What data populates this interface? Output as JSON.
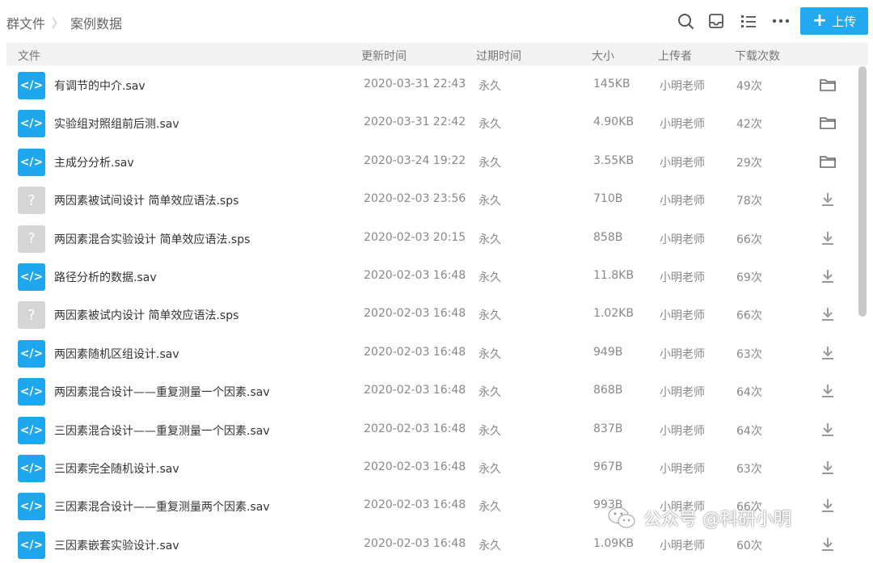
{
  "breadcrumb": {
    "root": "群文件",
    "separator": "〉",
    "current": "案例数据"
  },
  "toolbar": {
    "search_icon": "search-icon",
    "inbox_icon": "inbox-icon",
    "list_icon": "list-view-icon",
    "more_icon": "more-icon",
    "upload_label": "上传"
  },
  "colors": {
    "accent": "#21a9f1",
    "code_icon": "#1ea7ef",
    "unknown_icon": "#d5d5d5"
  },
  "table": {
    "columns": [
      "文件",
      "更新时间",
      "过期时间",
      "大小",
      "上传者",
      "下载次数"
    ],
    "rows": [
      {
        "name": "有调节的中介.sav",
        "time": "2020-03-31 22:43",
        "expire": "永久",
        "size": "145KB",
        "uploader": "小明老师",
        "downloads": "49次",
        "type": "code",
        "action": "folder-icon"
      },
      {
        "name": "实验组对照组前后测.sav",
        "time": "2020-03-31 22:42",
        "expire": "永久",
        "size": "4.90KB",
        "uploader": "小明老师",
        "downloads": "42次",
        "type": "code",
        "action": "folder-icon"
      },
      {
        "name": "主成分分析.sav",
        "time": "2020-03-24 19:22",
        "expire": "永久",
        "size": "3.55KB",
        "uploader": "小明老师",
        "downloads": "29次",
        "type": "code",
        "action": "folder-icon"
      },
      {
        "name": "两因素被试间设计 简单效应语法.sps",
        "time": "2020-02-03 23:56",
        "expire": "永久",
        "size": "710B",
        "uploader": "小明老师",
        "downloads": "78次",
        "type": "unknown",
        "action": "download-icon"
      },
      {
        "name": "两因素混合实验设计 简单效应语法.sps",
        "time": "2020-02-03 20:15",
        "expire": "永久",
        "size": "858B",
        "uploader": "小明老师",
        "downloads": "66次",
        "type": "unknown",
        "action": "download-icon"
      },
      {
        "name": "路径分析的数据.sav",
        "time": "2020-02-03 16:48",
        "expire": "永久",
        "size": "11.8KB",
        "uploader": "小明老师",
        "downloads": "69次",
        "type": "code",
        "action": "download-icon"
      },
      {
        "name": "两因素被试内设计 简单效应语法.sps",
        "time": "2020-02-03 16:48",
        "expire": "永久",
        "size": "1.02KB",
        "uploader": "小明老师",
        "downloads": "66次",
        "type": "unknown",
        "action": "download-icon"
      },
      {
        "name": "两因素随机区组设计.sav",
        "time": "2020-02-03 16:48",
        "expire": "永久",
        "size": "949B",
        "uploader": "小明老师",
        "downloads": "63次",
        "type": "code",
        "action": "download-icon"
      },
      {
        "name": "两因素混合设计——重复测量一个因素.sav",
        "time": "2020-02-03 16:48",
        "expire": "永久",
        "size": "868B",
        "uploader": "小明老师",
        "downloads": "64次",
        "type": "code",
        "action": "download-icon"
      },
      {
        "name": "三因素混合设计——重复测量一个因素.sav",
        "time": "2020-02-03 16:48",
        "expire": "永久",
        "size": "837B",
        "uploader": "小明老师",
        "downloads": "64次",
        "type": "code",
        "action": "download-icon"
      },
      {
        "name": "三因素完全随机设计.sav",
        "time": "2020-02-03 16:48",
        "expire": "永久",
        "size": "967B",
        "uploader": "小明老师",
        "downloads": "63次",
        "type": "code",
        "action": "download-icon"
      },
      {
        "name": "三因素混合设计——重复测量两个因素.sav",
        "time": "2020-02-03 16:48",
        "expire": "永久",
        "size": "993B",
        "uploader": "小明老师",
        "downloads": "66次",
        "type": "code",
        "action": "download-icon"
      },
      {
        "name": "三因素嵌套实验设计.sav",
        "time": "2020-02-03 16:48",
        "expire": "永久",
        "size": "1.09KB",
        "uploader": "小明老师",
        "downloads": "60次",
        "type": "code",
        "action": "download-icon"
      }
    ]
  },
  "watermark": {
    "text": "公众号 @科研小明"
  }
}
